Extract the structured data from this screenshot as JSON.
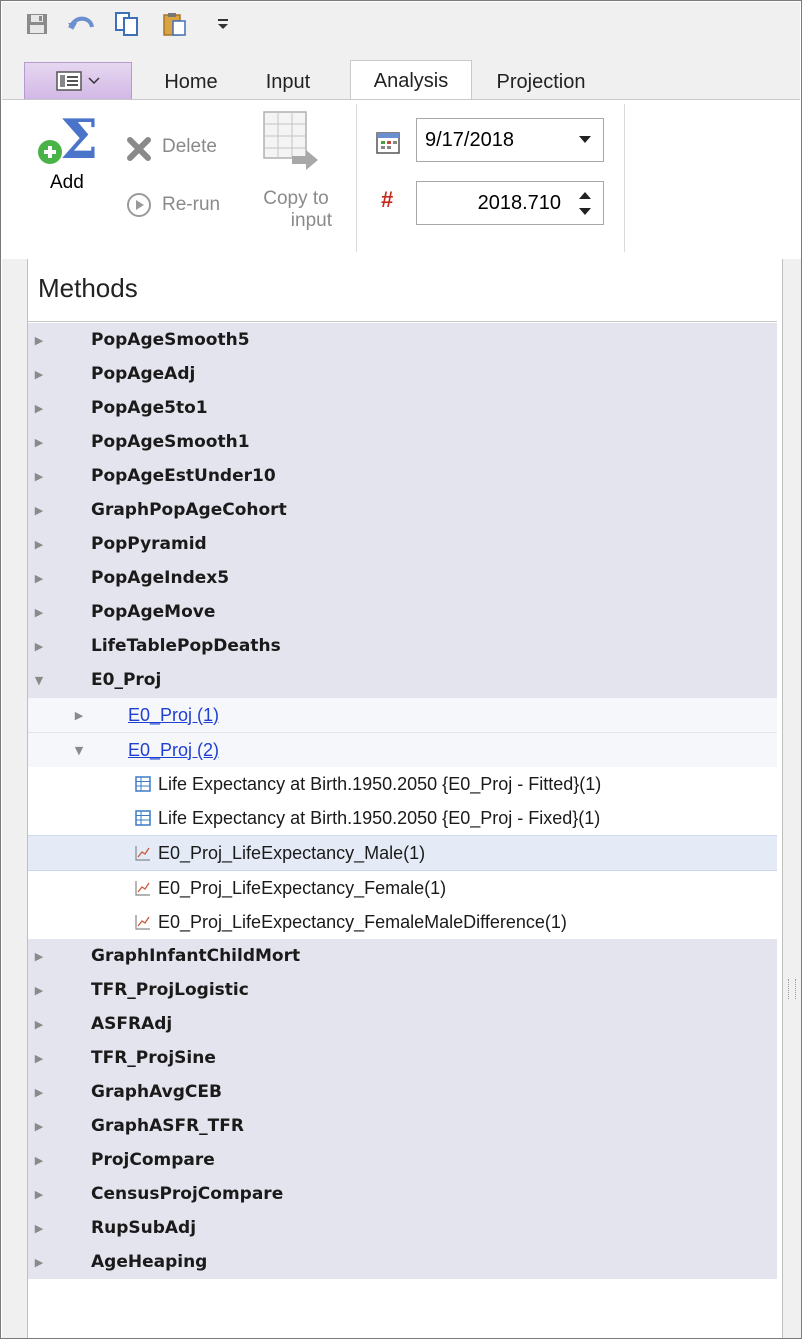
{
  "ribbon": {
    "tabs": [
      {
        "label": "Home",
        "active": false
      },
      {
        "label": "Input",
        "active": false
      },
      {
        "label": "Analysis",
        "active": true
      },
      {
        "label": "Projection",
        "active": false
      }
    ],
    "buttons": {
      "add": "Add",
      "delete": "Delete",
      "rerun": "Re-run",
      "copy_to_input_line1": "Copy to",
      "copy_to_input_line2": "input"
    },
    "date_value": "9/17/2018",
    "number_symbol": "#",
    "number_value": "2018.710"
  },
  "panel": {
    "title": "Methods"
  },
  "tree": {
    "before": [
      "PopAgeSmooth5",
      "PopAgeAdj",
      "PopAge5to1",
      "PopAgeSmooth1",
      "PopAgeEstUnder10",
      "GraphPopAgeCohort",
      "PopPyramid",
      "PopAgeIndex5",
      "PopAgeMove",
      "LifeTablePopDeaths"
    ],
    "expanded": "E0_Proj",
    "child1": "E0_Proj (1)",
    "child2": "E0_Proj (2)",
    "child2_items": [
      {
        "label": "Life Expectancy at Birth.1950.2050 {E0_Proj - Fitted}(1)",
        "icon": "table-icon",
        "selected": false
      },
      {
        "label": "Life Expectancy at Birth.1950.2050 {E0_Proj - Fixed}(1)",
        "icon": "table-icon",
        "selected": false
      },
      {
        "label": "E0_Proj_LifeExpectancy_Male(1)",
        "icon": "line-chart-icon",
        "selected": true
      },
      {
        "label": "E0_Proj_LifeExpectancy_Female(1)",
        "icon": "line-chart-icon",
        "selected": false
      },
      {
        "label": "E0_Proj_LifeExpectancy_FemaleMaleDifference(1)",
        "icon": "line-chart-icon",
        "selected": false
      }
    ],
    "after": [
      "GraphInfantChildMort",
      "TFR_ProjLogistic",
      "ASFRAdj",
      "TFR_ProjSine",
      "GraphAvgCEB",
      "GraphASFR_TFR",
      "ProjCompare",
      "CensusProjCompare",
      "RupSubAdj",
      "AgeHeaping"
    ]
  }
}
